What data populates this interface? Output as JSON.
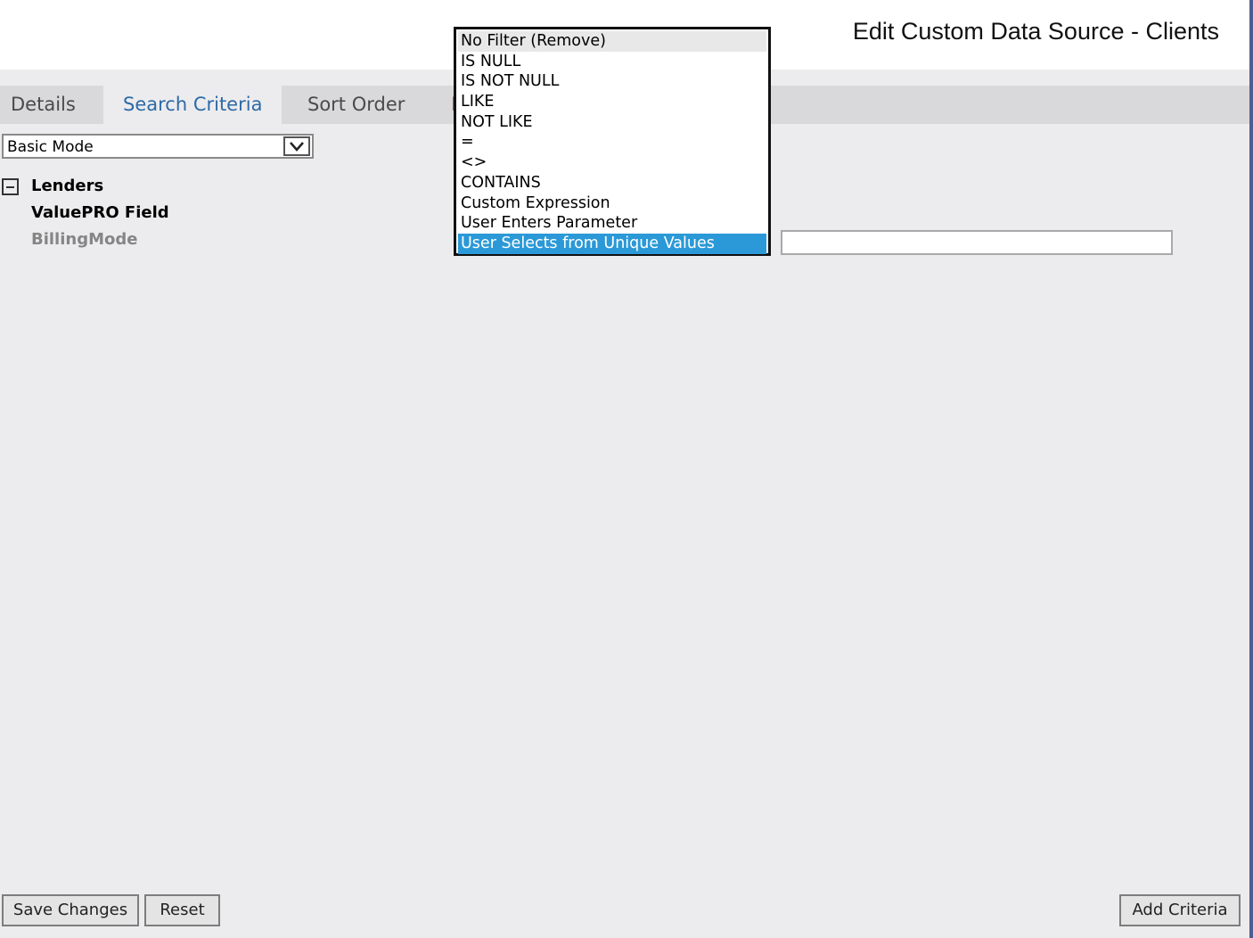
{
  "header": {
    "title": "Edit Custom Data Source - Clients"
  },
  "tabs": [
    {
      "label": "Details"
    },
    {
      "label": "Search Criteria"
    },
    {
      "label": "Sort Order"
    }
  ],
  "mode_select": {
    "value": "Basic Mode"
  },
  "tree": {
    "group_label": "Lenders",
    "column_header": "ValuePRO Field",
    "field": "BillingMode"
  },
  "operator_dropdown": {
    "options": [
      "No Filter (Remove)",
      "IS NULL",
      "IS NOT NULL",
      "LIKE",
      "NOT LIKE",
      "=",
      "<>",
      "CONTAINS",
      "Custom Expression",
      "User Enters Parameter",
      "User Selects from Unique Values"
    ],
    "selected": "User Selects from Unique Values",
    "highlight_color": "#2b99d7"
  },
  "value_input": {
    "value": ""
  },
  "buttons": {
    "save": "Save Changes",
    "reset": "Reset",
    "add": "Add Criteria"
  }
}
